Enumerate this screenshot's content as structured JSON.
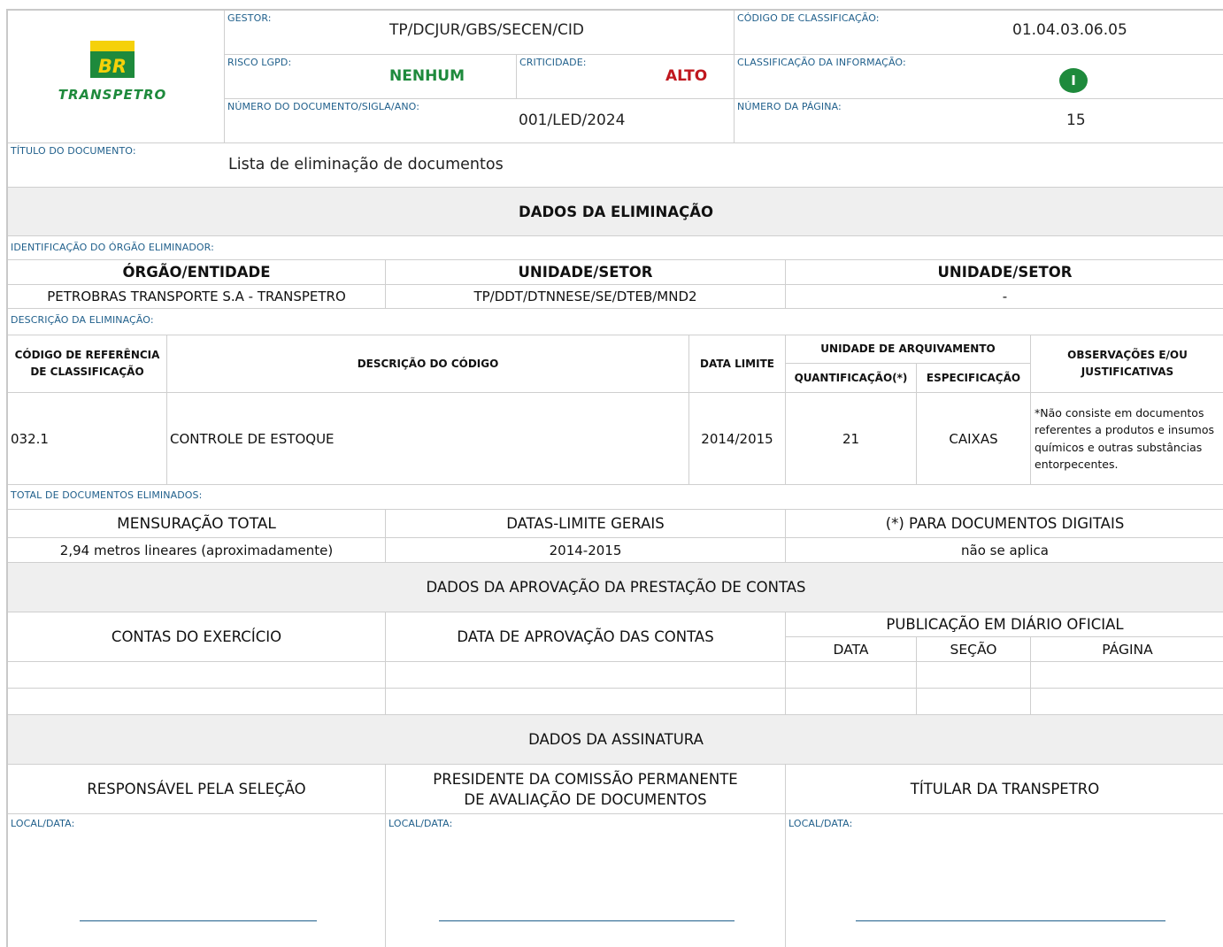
{
  "logo": {
    "brand": "BR",
    "name": "TRANSPETRO",
    "colors": {
      "yellow": "#f5d10a",
      "green": "#1e8a3c"
    }
  },
  "header": {
    "gestor_label": "GESTOR:",
    "gestor_value": "TP/DCJUR/GBS/SECEN/CID",
    "codigo_label": "CÓDIGO DE CLASSIFICAÇÃO:",
    "codigo_value": "01.04.03.06.05",
    "risco_label": "RISCO LGPD:",
    "risco_value": "NENHUM",
    "criticidade_label": "CRITICIDADE:",
    "criticidade_value": "ALTO",
    "classif_info_label": "CLASSIFICAÇÃO DA INFORMAÇÃO:",
    "classif_info_icon": "I",
    "numero_doc_label": "NÚMERO DO DOCUMENTO/SIGLA/ANO:",
    "numero_doc_value": "001/LED/2024",
    "pagina_label": "NÚMERO DA PÁGINA:",
    "pagina_value": "15",
    "titulo_label": "TÍTULO DO DOCUMENTO:",
    "titulo_value": "Lista de eliminação de documentos"
  },
  "dados_eliminacao": {
    "title": "DADOS DA ELIMINAÇÃO",
    "orgao_label": "IDENTIFICAÇÃO DO ÓRGÃO ELIMINADOR:",
    "col1": "ÓRGÃO/ENTIDADE",
    "col2": "UNIDADE/SETOR",
    "col3": "UNIDADE/SETOR",
    "val1": "PETROBRAS TRANSPORTE S.A - TRANSPETRO",
    "val2": "TP/DDT/DTNNESE/SE/DTEB/MND2",
    "val3": "-"
  },
  "descricao": {
    "label": "DESCRIÇÃO DA ELIMINAÇÃO:",
    "h_codigo_1": "CÓDIGO DE REFERÊNCIA",
    "h_codigo_2": "DE CLASSIFICAÇÃO",
    "h_descricao": "DESCRIÇÃO DO CÓDIGO",
    "h_data": "DATA LIMITE",
    "h_unidade": "UNIDADE DE ARQUIVAMENTO",
    "h_quant": "QUANTIFICAÇÃO(*)",
    "h_espec": "ESPECIFICAÇÃO",
    "h_obs_1": "OBSERVAÇÕES E/OU",
    "h_obs_2": "JUSTIFICATIVAS",
    "row": {
      "codigo": "032.1",
      "descricao": "CONTROLE DE ESTOQUE",
      "data": "2014/2015",
      "quant": "21",
      "espec": "CAIXAS",
      "obs": "*Não consiste em documentos referentes a produtos e insumos químicos e outras substâncias entorpecentes."
    }
  },
  "total": {
    "label": "TOTAL DE DOCUMENTOS ELIMINADOS:",
    "h1": "MENSURAÇÃO TOTAL",
    "h2": "DATAS-LIMITE GERAIS",
    "h3": "(*) PARA DOCUMENTOS DIGITAIS",
    "v1": "2,94 metros lineares (aproximadamente)",
    "v2": "2014-2015",
    "v3": "não se aplica"
  },
  "aprovacao": {
    "title": "DADOS DA APROVAÇÃO DA PRESTAÇÃO DE CONTAS",
    "h1": "CONTAS DO EXERCÍCIO",
    "h2": "DATA DE APROVAÇÃO DAS CONTAS",
    "h3": "PUBLICAÇÃO EM DIÁRIO OFICIAL",
    "h3a": "DATA",
    "h3b": "SEÇÃO",
    "h3c": "PÁGINA"
  },
  "assinatura": {
    "title": "DADOS DA ASSINATURA",
    "h1": "RESPONSÁVEL PELA SELEÇÃO",
    "h2_1": "PRESIDENTE DA COMISSÃO PERMANENTE",
    "h2_2": "DE AVALIAÇÃO DE DOCUMENTOS",
    "h3": "TÍTULAR DA TRANSPETRO",
    "local_label": "LOCAL/DATA:"
  }
}
